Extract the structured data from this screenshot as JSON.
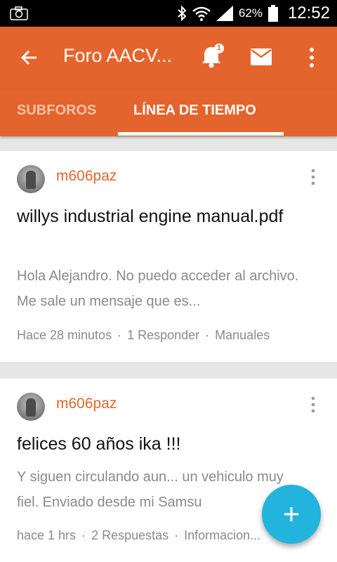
{
  "status_bar": {
    "battery_percent": "62%",
    "time": "12:52"
  },
  "app_bar": {
    "title": "Foro AACV...",
    "notification_count": "1"
  },
  "tabs": [
    {
      "label": "SUBFOROS"
    },
    {
      "label": "LÍNEA DE TIEMPO",
      "selected": true
    }
  ],
  "posts": [
    {
      "author": "m606paz",
      "title": "willys industrial engine manual.pdf",
      "excerpt": "Hola Alejandro. No puedo acceder al archivo. Me sale un mensaje que es...",
      "time": "Hace 28 minutos",
      "replies": "1 Responder",
      "forum": "Manuales"
    },
    {
      "author": "m606paz",
      "title": "felices 60 años ika !!!",
      "excerpt": "Y siguen circulando aun... un vehiculo muy fiel. Enviado desde mi Samsu",
      "time": "hace 1 hrs",
      "replies": "2 Respuestas",
      "forum": "Informacion..."
    }
  ],
  "colors": {
    "accent": "#e3642c",
    "fab": "#22b4dd"
  },
  "icons": [
    "camera-icon",
    "bluetooth-icon",
    "wifi-icon",
    "signal-icon",
    "battery-icon",
    "back-arrow-icon",
    "bell-icon",
    "mail-icon",
    "more-vert-icon",
    "plus-icon"
  ]
}
